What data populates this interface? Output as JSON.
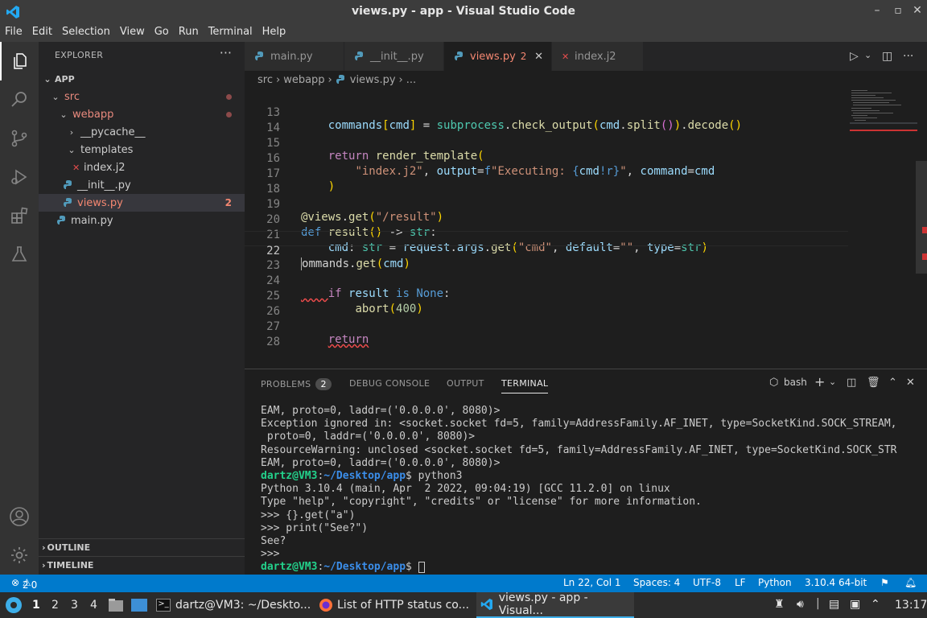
{
  "window": {
    "title": "views.py - app - Visual Studio Code"
  },
  "menu": [
    "File",
    "Edit",
    "Selection",
    "View",
    "Go",
    "Run",
    "Terminal",
    "Help"
  ],
  "explorer": {
    "header": "EXPLORER",
    "root": "APP",
    "items": [
      {
        "label": "src"
      },
      {
        "label": "webapp"
      },
      {
        "label": "__pycache__"
      },
      {
        "label": "templates"
      },
      {
        "label": "index.j2"
      },
      {
        "label": "__init__.py"
      },
      {
        "label": "views.py",
        "badge": "2"
      },
      {
        "label": "main.py"
      }
    ],
    "outline": "OUTLINE",
    "timeline": "TIMELINE"
  },
  "tabs": [
    {
      "label": "main.py"
    },
    {
      "label": "__init__.py"
    },
    {
      "label": "views.py",
      "errors": "2"
    },
    {
      "label": "index.j2"
    }
  ],
  "breadcrumb": {
    "parts": [
      "src",
      "webapp",
      "views.py",
      "..."
    ]
  },
  "editor": {
    "line_numbers": [
      "13",
      "14",
      "15",
      "16",
      "17",
      "18",
      "19",
      "20",
      "21",
      "22",
      "23",
      "24",
      "25",
      "26",
      "27",
      "28"
    ]
  },
  "panel": {
    "tabs": [
      "PROBLEMS",
      "DEBUG CONSOLE",
      "OUTPUT",
      "TERMINAL"
    ],
    "problems_count": "2",
    "shell": "bash",
    "terminal": {
      "line1": "EAM, proto=0, laddr=('0.0.0.0', 8080)>",
      "line2": "Exception ignored in: <socket.socket fd=5, family=AddressFamily.AF_INET, type=SocketKind.SOCK_STREAM,",
      "line3": " proto=0, laddr=('0.0.0.0', 8080)>",
      "line4": "ResourceWarning: unclosed <socket.socket fd=5, family=AddressFamily.AF_INET, type=SocketKind.SOCK_STR",
      "line5": "EAM, proto=0, laddr=('0.0.0.0', 8080)>",
      "prompt_user": "dartz@VM3",
      "prompt_path": "~/Desktop/app",
      "cmd1": "$ python3",
      "line7": "Python 3.10.4 (main, Apr  2 2022, 09:04:19) [GCC 11.2.0] on linux",
      "line8": "Type \"help\", \"copyright\", \"credits\" or \"license\" for more information.",
      "line9": ">>> {}.get(\"a\")",
      "line10": ">>> print(\"See?\")",
      "line11": "See?",
      "line12": ">>>",
      "cmd2": "$ "
    }
  },
  "status": {
    "errors": "2",
    "warnings": "0",
    "position": "Ln 22, Col 1",
    "spaces": "Spaces: 4",
    "encoding": "UTF-8",
    "eol": "LF",
    "language": "Python",
    "interpreter": "3.10.4 64-bit"
  },
  "taskbar": {
    "workspaces": [
      "1",
      "2",
      "3",
      "4"
    ],
    "apps": [
      {
        "label": "dartz@VM3: ~/Deskto..."
      },
      {
        "label": "List of HTTP status co..."
      },
      {
        "label": "views.py - app - Visual..."
      }
    ],
    "clock": "13:17"
  },
  "colors": {
    "accent": "#007acc",
    "error": "#f48771",
    "titlebar": "#3c3c3c"
  }
}
